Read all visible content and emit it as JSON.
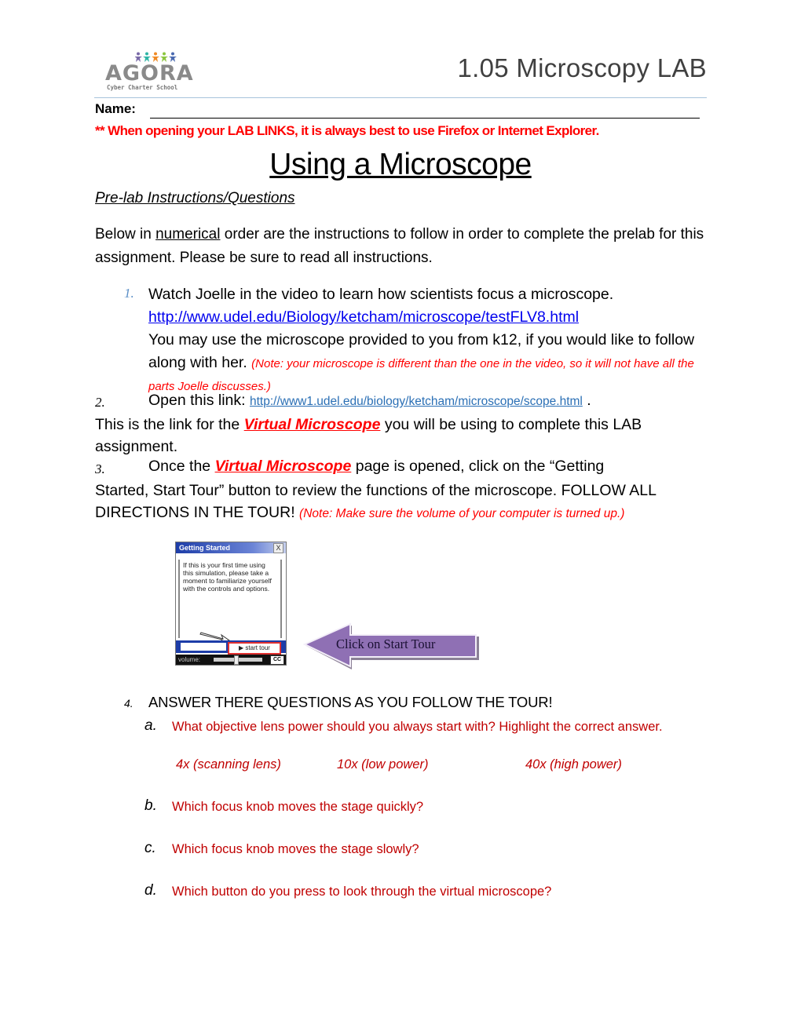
{
  "header": {
    "logo": {
      "name": "AGORA",
      "subtitle": "Cyber Charter School",
      "figure_colors": [
        "#7a6aa8",
        "#2fb5a6",
        "#f08a24",
        "#8cc63f",
        "#4a6ab0"
      ]
    },
    "doc_title": "1.05 Microscopy LAB"
  },
  "name_field": {
    "label": "Name:",
    "value": ""
  },
  "warning": "** When opening your LAB LINKS, it is always best to use Firefox or Internet Explorer.",
  "heading": "Using a Microscope",
  "subheading": "Pre-lab Instructions/Questions",
  "intro": {
    "before": "Below in ",
    "underlined": "numerical",
    "after": " order are the instructions to follow in order to complete the prelab for this assignment. Please be sure to read all instructions."
  },
  "steps": [
    {
      "number": "1.",
      "text": "Watch Joelle in the video to learn how scientists focus a microscope.",
      "link": "http://www.udel.edu/Biology/ketcham/microscope/testFLV8.html",
      "text2": "You may use the microscope provided to you from k12, if you would like to follow along with her. ",
      "note": "(Note: your microscope is different than the one in the video, so it will not have all the parts Joelle discusses.)"
    },
    {
      "number": "2.",
      "prefix": "Open this link: ",
      "link": "http://www1.udel.edu/biology/ketcham/microscope/scope.html",
      "suffix": " .",
      "text_before": "This is the link for the ",
      "highlight": "Virtual Microscope",
      "text_after": " you will be using to complete this LAB assignment."
    },
    {
      "number": "3.",
      "prefix": "Once the ",
      "highlight": "Virtual Microscope",
      "line1_after": " page is opened, click on the “Getting",
      "rest": "Started, Start Tour” button to review the functions of the microscope. FOLLOW ALL DIRECTIONS IN THE TOUR! ",
      "note": "(Note: Make sure the volume of your computer is turned up.)"
    },
    {
      "number": "4.",
      "text": "ANSWER THERE QUESTIONS AS YOU FOLLOW THE TOUR!"
    }
  ],
  "getting_started_image": {
    "title": "Getting Started",
    "close": "X",
    "body": "If this  is your first time using this simulation, please take a moment to familiarize yourself with the controls and options.",
    "start_button": "▶  start tour",
    "volume_label": "volume:",
    "volume_level": 0.45,
    "cc_label": "CC"
  },
  "arrow_callout": "Click on Start Tour",
  "questions": [
    {
      "letter": "a.",
      "text": "What objective lens power should you always start with? Highlight the correct answer.",
      "options": [
        "4x (scanning lens)",
        "10x (low power)",
        "40x (high power)"
      ]
    },
    {
      "letter": "b.",
      "text": "Which focus knob moves the stage quickly?"
    },
    {
      "letter": "c.",
      "text": "Which focus knob moves the stage slowly?"
    },
    {
      "letter": "d.",
      "text": "Which button do you press to look through the virtual microscope?"
    }
  ]
}
